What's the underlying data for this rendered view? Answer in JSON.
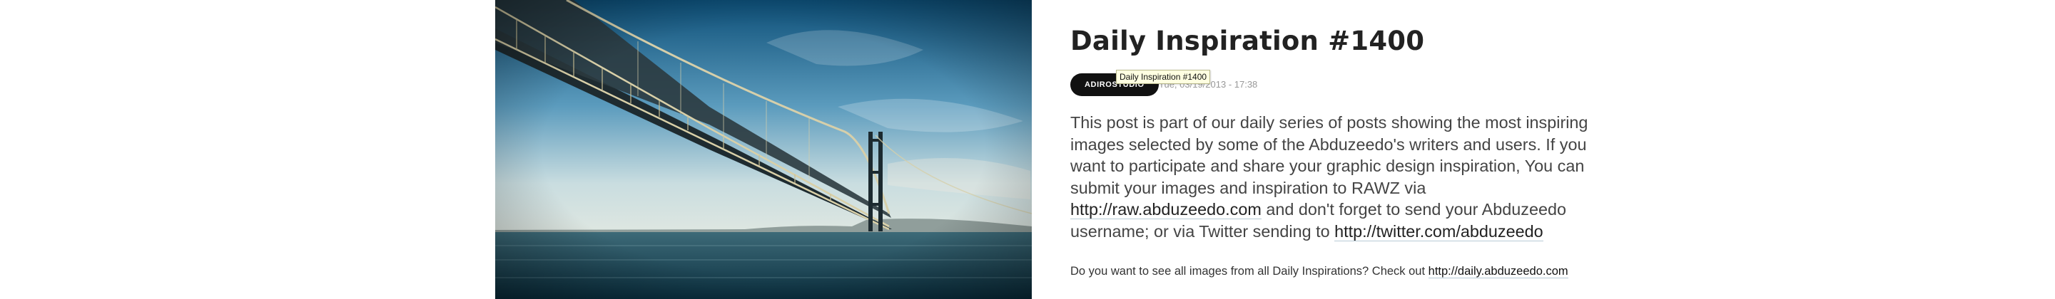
{
  "hero_image": {
    "alt": "Suspension bridge over the sea under a blue sky"
  },
  "post": {
    "title": "Daily Inspiration #1400",
    "author": "ADIROSTUDIO",
    "date": "Tue, 03/19/2013 - 17:38",
    "tooltip": "Daily Inspiration #1400",
    "body_1": "This post is part of our daily series of posts showing the most inspiring images selected by some of the Abduzeedo's writers and users. If you want to participate and share your graphic design inspiration, You can submit your images and inspiration to RAWZ via ",
    "raw_link": "http://raw.abduzeedo.com",
    "body_2": " and don't forget to send your Abduzeedo username; or via Twitter sending to ",
    "twitter_link": "http://twitter.com/abduzeedo",
    "note_text": "Do you want to see all images from all Daily Inspirations? Check out ",
    "note_link": "http://daily.abduzeedo.com"
  },
  "colors": {
    "author_badge_bg": "#111111",
    "tooltip_bg": "#ffffe1",
    "link_underline": "#b8cbd6"
  }
}
